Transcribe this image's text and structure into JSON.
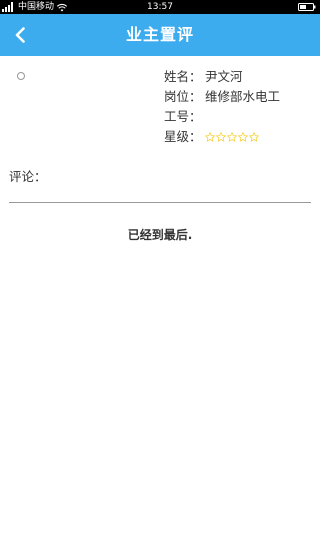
{
  "status_bar": {
    "carrier": "中国移动",
    "time": "13:57"
  },
  "header": {
    "title": "业主置评",
    "back_icon": "chevron-left-icon"
  },
  "worker": {
    "name_label": "姓名：",
    "name_value": "尹文河",
    "position_label": "岗位：",
    "position_value": "维修部水电工",
    "id_label": "工号：",
    "id_value": "",
    "rating_label": "星级：",
    "rating_value": 0,
    "rating_max": 5,
    "star_color": "#f5d23a"
  },
  "comment": {
    "label": "评论：",
    "value": ""
  },
  "list_end_text": "已经到最后.",
  "colors": {
    "header_bg": "#3cacef",
    "status_bg": "#000000"
  }
}
